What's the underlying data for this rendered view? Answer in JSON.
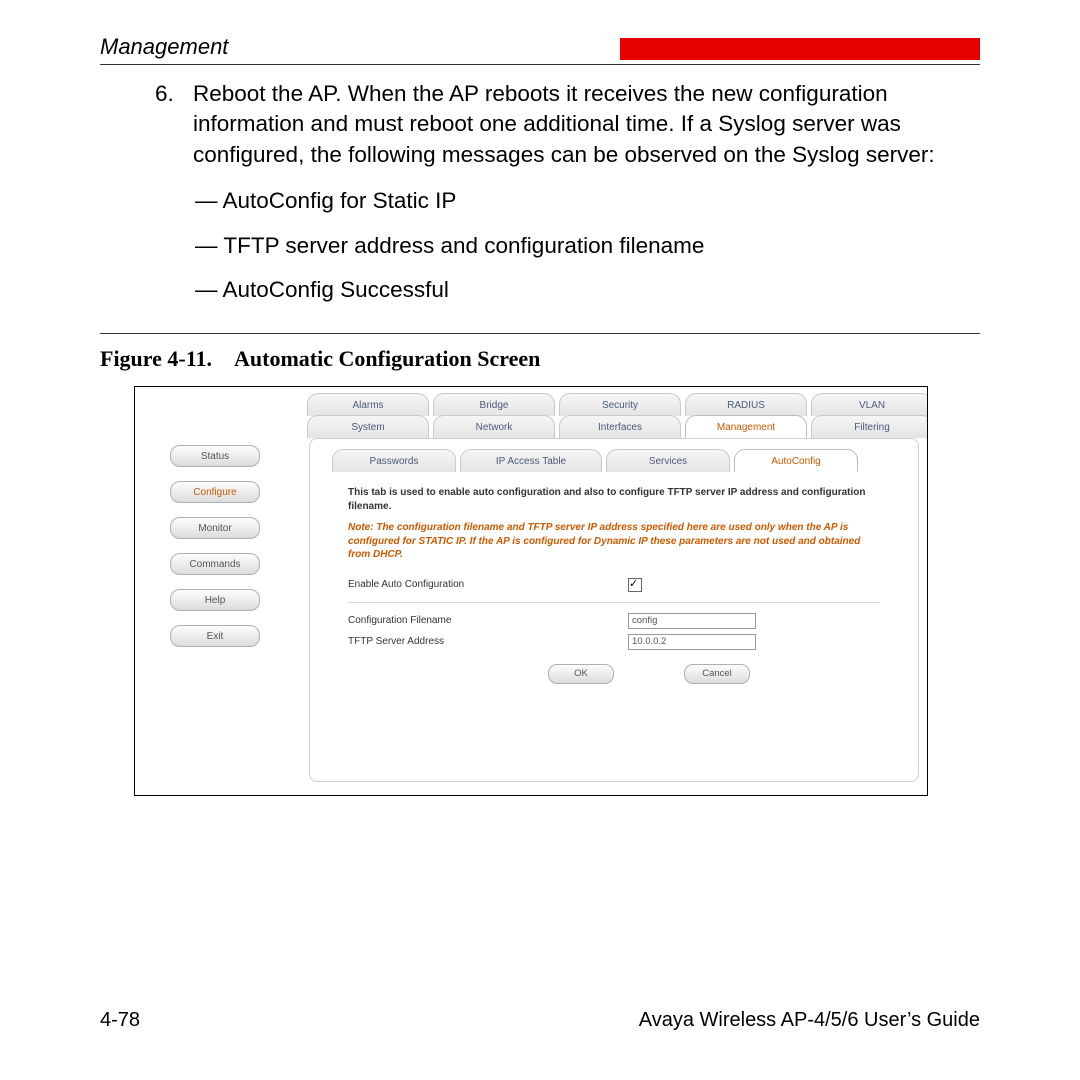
{
  "header": {
    "section": "Management"
  },
  "step": {
    "num": "6.",
    "para": "Reboot the AP. When the AP reboots it receives the new configuration information and must reboot one additional time. If a Syslog server was configured, the following messages can be observed on the Syslog server:"
  },
  "bullets": {
    "b1": "— AutoConfig for Static IP",
    "b2": "— TFTP server address and configuration filename",
    "b3": "— AutoConfig Successful"
  },
  "figure": {
    "label": "Figure 4-11.",
    "title": "Automatic Configuration Screen"
  },
  "sidebar": {
    "status": "Status",
    "configure": "Configure",
    "monitor": "Monitor",
    "commands": "Commands",
    "help": "Help",
    "exit": "Exit"
  },
  "toptabs": {
    "alarms": "Alarms",
    "bridge": "Bridge",
    "security": "Security",
    "radius": "RADIUS",
    "vlan": "VLAN",
    "system": "System",
    "network": "Network",
    "interfaces": "Interfaces",
    "management": "Management",
    "filtering": "Filtering"
  },
  "subtabs": {
    "passwords": "Passwords",
    "iptable": "IP Access Table",
    "services": "Services",
    "autoconfig": "AutoConfig"
  },
  "panel": {
    "desc": "This tab is used to enable auto configuration and also to configure TFTP server IP address and configuration filename.",
    "note": "Note: The configuration filename and TFTP server IP address specified here are used only when the AP is configured for STATIC IP. If the AP is configured for Dynamic IP these parameters are not used and obtained from DHCP.",
    "enable_label": "Enable Auto Configuration",
    "cfgname_label": "Configuration Filename",
    "cfgname_value": "config",
    "tftp_label": "TFTP Server Address",
    "tftp_value": "10.0.0.2",
    "ok": "OK",
    "cancel": "Cancel"
  },
  "footer": {
    "page": "4-78",
    "book": "Avaya Wireless AP-4/5/6 User’s Guide"
  }
}
